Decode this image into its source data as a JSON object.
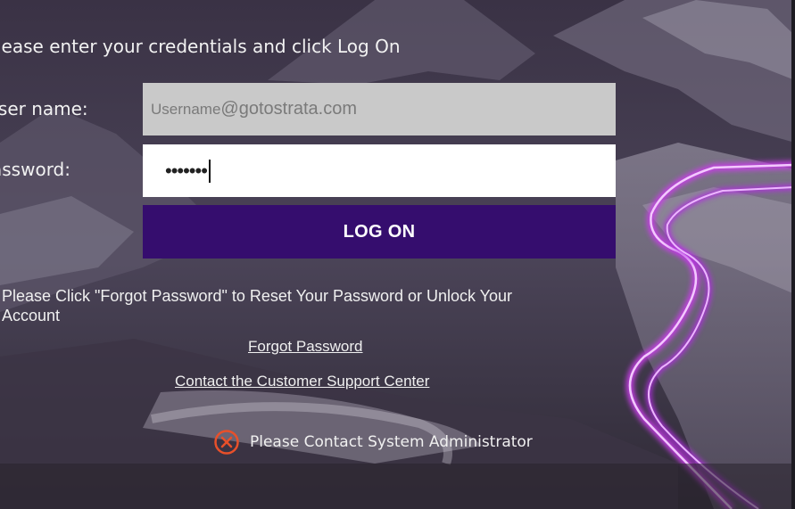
{
  "login": {
    "instruction": "lease enter your credentials and click Log On",
    "username_label": "Jser name:",
    "password_label": "assword:",
    "username_value_part1": "Username",
    "username_value_part2": "@gotostrata.com",
    "password_mask": "•••••••",
    "logon_label": "LOG ON",
    "forgot_note": "Please Click \"Forgot Password\" to Reset Your Password or Unlock Your Account",
    "forgot_link": "Forgot Password",
    "support_link": "Contact the Customer Support Center",
    "error_message": "Please Contact System Administrator"
  },
  "colors": {
    "button": "#350d6e",
    "username_field": "#c9c9c9",
    "password_field": "#ffffff",
    "error_icon": "#e8502a",
    "light_trail": "#d040f0"
  },
  "icons": {
    "error": "close-circle-icon"
  }
}
